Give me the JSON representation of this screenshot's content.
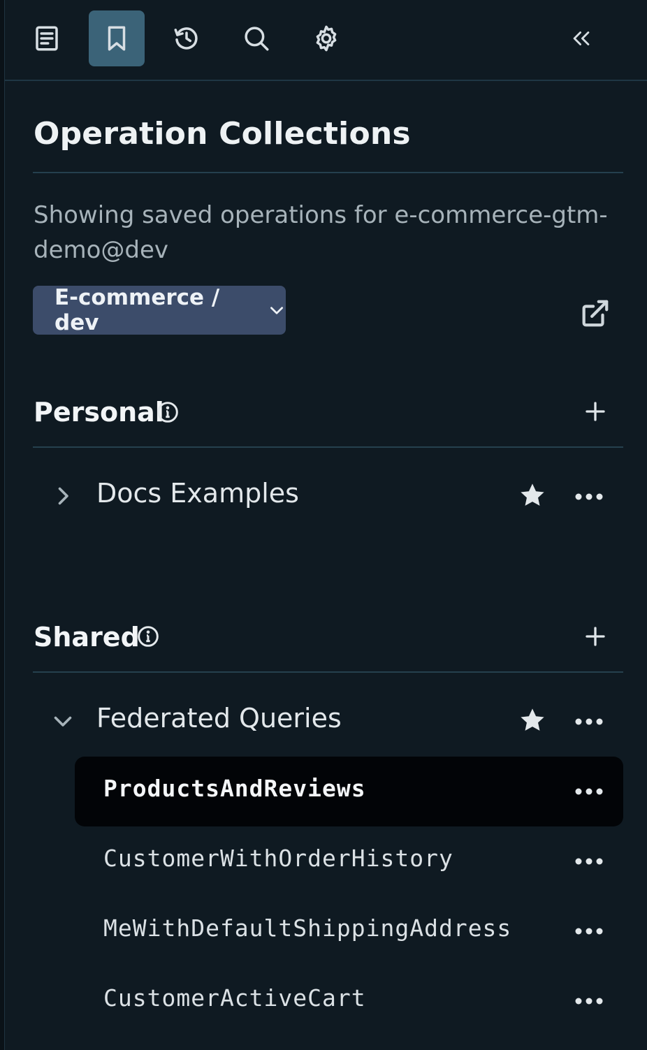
{
  "toolbar": {
    "items": [
      {
        "name": "document-icon",
        "active": false
      },
      {
        "name": "bookmark-icon",
        "active": true
      },
      {
        "name": "history-icon",
        "active": false
      },
      {
        "name": "search-icon",
        "active": false
      },
      {
        "name": "gear-icon",
        "active": false
      }
    ],
    "collapse_icon": "double-chevron-left-icon"
  },
  "panel": {
    "title": "Operation Collections",
    "description": "Showing saved operations for e-commerce-gtm-demo@dev",
    "graph_selector": {
      "label": "E-commerce / dev"
    }
  },
  "personal": {
    "heading": "Personal",
    "collections": [
      {
        "name": "Docs Examples",
        "expanded": false,
        "starred": true
      }
    ]
  },
  "shared": {
    "heading": "Shared",
    "collections": [
      {
        "name": "Federated Queries",
        "expanded": true,
        "starred": true,
        "operations": [
          {
            "name": "ProductsAndReviews",
            "selected": true
          },
          {
            "name": "CustomerWithOrderHistory",
            "selected": false
          },
          {
            "name": "MeWithDefaultShippingAddress",
            "selected": false
          },
          {
            "name": "CustomerActiveCart",
            "selected": false
          }
        ]
      }
    ]
  },
  "colors": {
    "background": "#0f1a22",
    "active_tab": "#3b6378",
    "graph_selector_bg": "#3c4c6a",
    "selected_row": "#020407"
  }
}
